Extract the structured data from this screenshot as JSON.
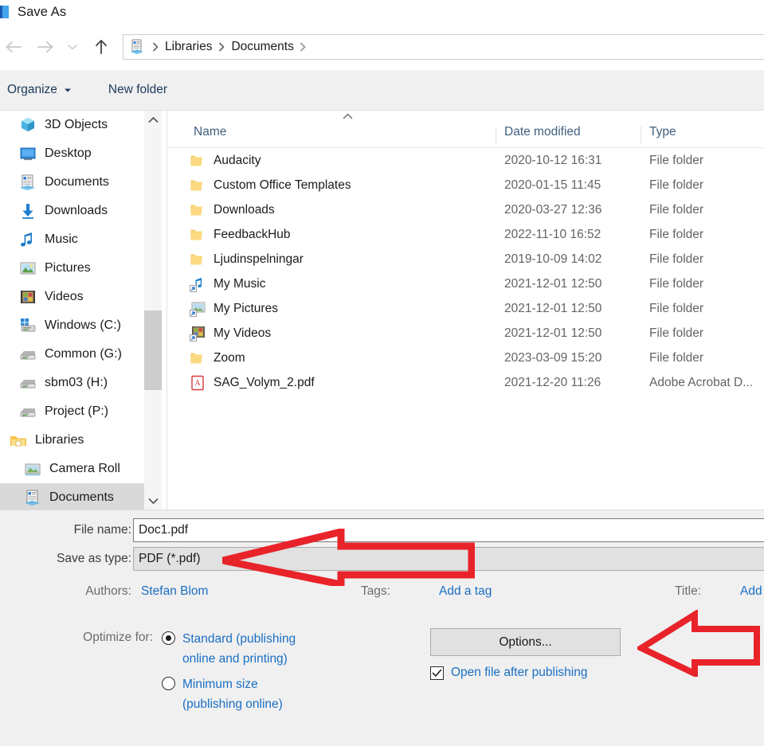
{
  "window": {
    "title": "Save As",
    "app_icon": "word-document-icon"
  },
  "nav": {
    "back": "back-arrow",
    "forward": "forward-arrow",
    "recent": "recent-locations-chevron",
    "up": "up-arrow",
    "breadcrumb": {
      "icon": "documents-library-icon",
      "crumbs": [
        "Libraries",
        "Documents"
      ],
      "separator": "›"
    }
  },
  "command_bar": {
    "organize": "Organize",
    "organize_caret": "▾",
    "new_folder": "New folder"
  },
  "sidebar": {
    "items": [
      {
        "label": "3D Objects",
        "icon": "3d-objects-icon",
        "indent": 1,
        "selected": false
      },
      {
        "label": "Desktop",
        "icon": "desktop-icon",
        "indent": 1,
        "selected": false
      },
      {
        "label": "Documents",
        "icon": "documents-icon",
        "indent": 1,
        "selected": false
      },
      {
        "label": "Downloads",
        "icon": "downloads-icon",
        "indent": 1,
        "selected": false
      },
      {
        "label": "Music",
        "icon": "music-icon",
        "indent": 1,
        "selected": false
      },
      {
        "label": "Pictures",
        "icon": "pictures-icon",
        "indent": 1,
        "selected": false
      },
      {
        "label": "Videos",
        "icon": "videos-icon",
        "indent": 1,
        "selected": false
      },
      {
        "label": "Windows (C:)",
        "icon": "windows-drive-icon",
        "indent": 1,
        "selected": false
      },
      {
        "label": "Common (G:)",
        "icon": "network-drive-icon",
        "indent": 1,
        "selected": false
      },
      {
        "label": "sbm03 (H:)",
        "icon": "network-drive-icon",
        "indent": 1,
        "selected": false
      },
      {
        "label": "Project (P:)",
        "icon": "network-drive-icon",
        "indent": 1,
        "selected": false
      },
      {
        "label": "Libraries",
        "icon": "libraries-icon",
        "indent": 0,
        "selected": false
      },
      {
        "label": "Camera Roll",
        "icon": "camera-roll-icon",
        "indent": 2,
        "selected": false
      },
      {
        "label": "Documents",
        "icon": "documents-icon",
        "indent": 2,
        "selected": true
      }
    ],
    "scroll_up": "scroll-up-chevron",
    "scroll_down": "scroll-down-chevron"
  },
  "file_list": {
    "sort_indicator": "sort-ascending-chevron",
    "columns": [
      "Name",
      "Date modified",
      "Type"
    ],
    "rows": [
      {
        "name": "Audacity",
        "date": "2020-10-12 16:31",
        "type": "File folder",
        "icon": "folder-icon"
      },
      {
        "name": "Custom Office Templates",
        "date": "2020-01-15 11:45",
        "type": "File folder",
        "icon": "folder-icon"
      },
      {
        "name": "Downloads",
        "date": "2020-03-27 12:36",
        "type": "File folder",
        "icon": "folder-icon"
      },
      {
        "name": "FeedbackHub",
        "date": "2022-11-10 16:52",
        "type": "File folder",
        "icon": "folder-icon"
      },
      {
        "name": "Ljudinspelningar",
        "date": "2019-10-09 14:02",
        "type": "File folder",
        "icon": "folder-icon"
      },
      {
        "name": "My Music",
        "date": "2021-12-01 12:50",
        "type": "File folder",
        "icon": "music-shortcut-icon"
      },
      {
        "name": "My Pictures",
        "date": "2021-12-01 12:50",
        "type": "File folder",
        "icon": "pictures-shortcut-icon"
      },
      {
        "name": "My Videos",
        "date": "2021-12-01 12:50",
        "type": "File folder",
        "icon": "videos-shortcut-icon"
      },
      {
        "name": "Zoom",
        "date": "2023-03-09 15:20",
        "type": "File folder",
        "icon": "folder-icon"
      },
      {
        "name": "SAG_Volym_2.pdf",
        "date": "2021-12-20 11:26",
        "type": "Adobe Acrobat D...",
        "icon": "pdf-icon"
      }
    ]
  },
  "form": {
    "file_name_label": "File name:",
    "file_name_value": "Doc1.pdf",
    "save_as_type_label": "Save as type:",
    "save_as_type_value": "PDF (*.pdf)",
    "authors_label": "Authors:",
    "authors_value": "Stefan Blom",
    "tags_label": "Tags:",
    "tags_value": "Add a tag",
    "title_label": "Title:",
    "title_value": "Add",
    "optimize_label": "Optimize for:",
    "optimize_options": [
      {
        "line1": "Standard (publishing",
        "line2": "online and printing)",
        "selected": true
      },
      {
        "line1": "Minimum size",
        "line2": "(publishing online)",
        "selected": false
      }
    ],
    "options_button": "Options...",
    "open_after_publishing_label": "Open file after publishing",
    "open_after_publishing_checked": true,
    "checkmark": "✓"
  },
  "annotations": {
    "arrow_color": "#e8232a",
    "arrows": [
      {
        "name": "arrow-pointing-to-save-as-type",
        "direction": "left"
      },
      {
        "name": "arrow-pointing-to-options-button",
        "direction": "left"
      }
    ]
  }
}
